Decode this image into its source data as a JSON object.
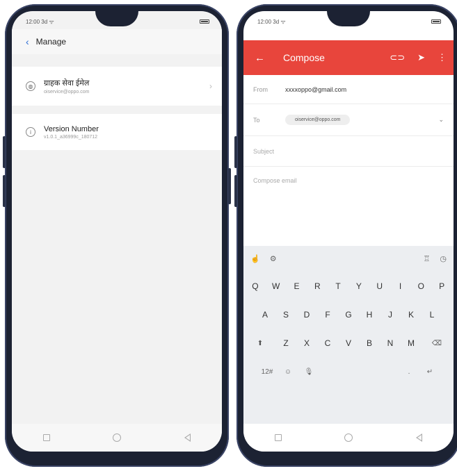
{
  "left_phone": {
    "status_time": "12:00 3d ᯤ",
    "header": {
      "back_icon": "chevron-left-icon",
      "title": "Manage"
    },
    "items": [
      {
        "icon": "globe-icon",
        "title": "ग्राहक सेवा ईमेल",
        "subtitle": "oiservice@oppo.com"
      },
      {
        "icon": "info-icon",
        "title": "Version Number",
        "subtitle": "v1.0.1_a36999c_180712"
      }
    ],
    "nav": [
      "square-icon",
      "circle-icon",
      "back-triangle-icon"
    ]
  },
  "right_phone": {
    "status_time": "12:00 3d ᯤ",
    "appbar": {
      "title": "Compose",
      "color": "#e8453c",
      "actions": [
        "attach-icon",
        "send-icon",
        "more-icon"
      ]
    },
    "from": {
      "label": "From",
      "value": "xxxxoppo@gmail.com"
    },
    "to": {
      "label": "To",
      "chip": "oiservice@oppo.com"
    },
    "subject_placeholder": "Subject",
    "body_placeholder": "Compose email",
    "keyboard": {
      "row1": [
        "Q",
        "W",
        "E",
        "R",
        "T",
        "Y",
        "U",
        "I",
        "O",
        "P"
      ],
      "row2": [
        "A",
        "S",
        "D",
        "F",
        "G",
        "H",
        "J",
        "K",
        "L"
      ],
      "row3": [
        "Z",
        "X",
        "C",
        "V",
        "B",
        "N",
        "M"
      ],
      "symbols_key": "12#",
      "return_key": "↵"
    }
  }
}
